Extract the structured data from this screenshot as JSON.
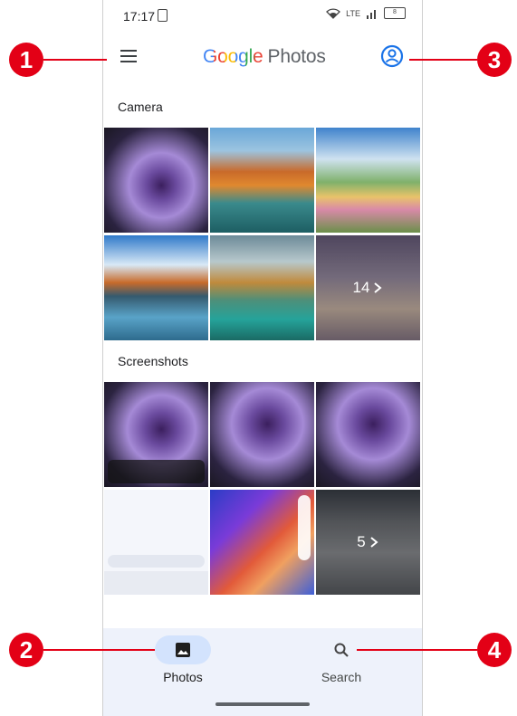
{
  "status_bar": {
    "time": "17:17",
    "network": "LTE",
    "battery": "8"
  },
  "app_bar": {
    "logo_google": "Google",
    "logo_photos": "Photos"
  },
  "sections": [
    {
      "title": "Camera",
      "more_count": "14"
    },
    {
      "title": "Screenshots",
      "more_count": "5"
    }
  ],
  "bottom_nav": {
    "photos_label": "Photos",
    "search_label": "Search"
  },
  "callouts": [
    "1",
    "2",
    "3",
    "4"
  ],
  "colors": {
    "accent": "#1a73e8",
    "callout": "#e30016",
    "nav_bg": "#eef2fb",
    "active_pill": "#d3e3fd"
  }
}
